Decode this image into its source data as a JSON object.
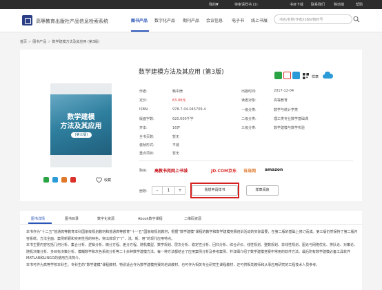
{
  "topbar": {
    "user": "我的▼",
    "cart": "待审请样书 (1)",
    "cart_highlight_color": "#ffffff",
    "links": [
      "书目下载",
      "联系我们",
      "移动端",
      "帮助"
    ]
  },
  "header": {
    "site_title": "高等教育出版社产品信息检索系统",
    "nav": [
      "图书产品",
      "数字化产品",
      "期刊产品",
      "会议信息",
      "电子书",
      "线上书展"
    ],
    "search_placeholder": "书名/名称/作者/ISBN/物料号"
  },
  "breadcrumb": {
    "items": [
      "首页",
      "图书产品",
      "数学建模方法及其应用 (第3版)"
    ],
    "separator": ">"
  },
  "cover": {
    "title_line1": "数学建模",
    "title_line2": "方法及其应用",
    "edition": "(第三版)"
  },
  "actions": {
    "favorite_label": "收藏",
    "icon_colors": [
      "#2aa344",
      "#d9302b",
      "#2a9bd6",
      "#333333"
    ]
  },
  "book": {
    "title": "数学建模方法及其应用 (第3版)",
    "sample_label": "样章",
    "meta_left": [
      {
        "label": "作者:",
        "value": "韩中庚"
      },
      {
        "label": "定价:",
        "value": "63.00元"
      },
      {
        "label": "ISBN:",
        "value": "978-7-04-045709-4"
      },
      {
        "label": "版面字数:",
        "value": "620.000千字"
      },
      {
        "label": "开本:",
        "value": "16开"
      },
      {
        "label": "全书页数:",
        "value": "暂无"
      },
      {
        "label": "装帧形式:",
        "value": "平装"
      },
      {
        "label": "重点项目:",
        "value": "暂无"
      }
    ],
    "meta_right": [
      {
        "label": "出版时间:",
        "value": "2017-12-04"
      },
      {
        "label": "读者对象:",
        "value": "高等教育"
      },
      {
        "label": "一级分类:",
        "value": "数学与统计学类"
      },
      {
        "label": "二级分类:",
        "value": "理工类专业数学基础课"
      },
      {
        "label": "三级分类:",
        "value": "数学建模与数学实验"
      }
    ]
  },
  "purchase": {
    "label": "购买:",
    "stores": [
      {
        "name": "高教书苑网上书城",
        "color": "#c8161d"
      },
      {
        "name": "JD.COM京东",
        "color": "#d9302b"
      },
      {
        "name": "当当网",
        "color": "#e0782a"
      },
      {
        "name": "amazon",
        "color": "#222222"
      }
    ]
  },
  "quantity": {
    "label": "册数:",
    "minus": "-",
    "value": "1",
    "plus": "+",
    "request_button": "我想申请样书",
    "sample_button": "样章阅读"
  },
  "tabs": [
    "图书详情",
    "图书目录",
    "数字化资源",
    "Abook数字课程",
    "二维码资源"
  ],
  "description": [
    "本书作为“十二五”普通高等教育本科国家级规划教材和普通高等教育“十一五”国家级规划教材，根据“数学建模”课程的教学和数学建模竞赛培训活动的实际需要，在第二版的基础上修订而成。第三版仍然保持了第二版内容系统、方法全面、案例新颖和实用性强的特色，突出体现了“广、浅、新、用”的现代应用特点。",
    "本书主要内容包括几何分析、集合分析、逻辑分析、微分方程、差分方程、随机模型、数学规划、层次分析、稳定性分析、回归分析、综合评价、线性规划、整数规划、非线性规划、图论与网络优化、排队论、对策论、随机决策分析、多目标决策分析、模糊数学和灰色系统分析等二十余种数学建模方法，每一种方法都结合了应用案例分析及参考案例、并详细介绍了数学建模竞赛中常用的软件方法。最后附有数学建模必备工具软件MATLAB和LINGO的使用方法简介。",
    "本书可作为高等学校本科生、专科生的“数学建模”课程教材，特别适合作为数学建模竞赛的培训教材，也可作为相关专业研究生课程教材，还可供相关教师和从事应用研究的工程技术人员参考。"
  ]
}
